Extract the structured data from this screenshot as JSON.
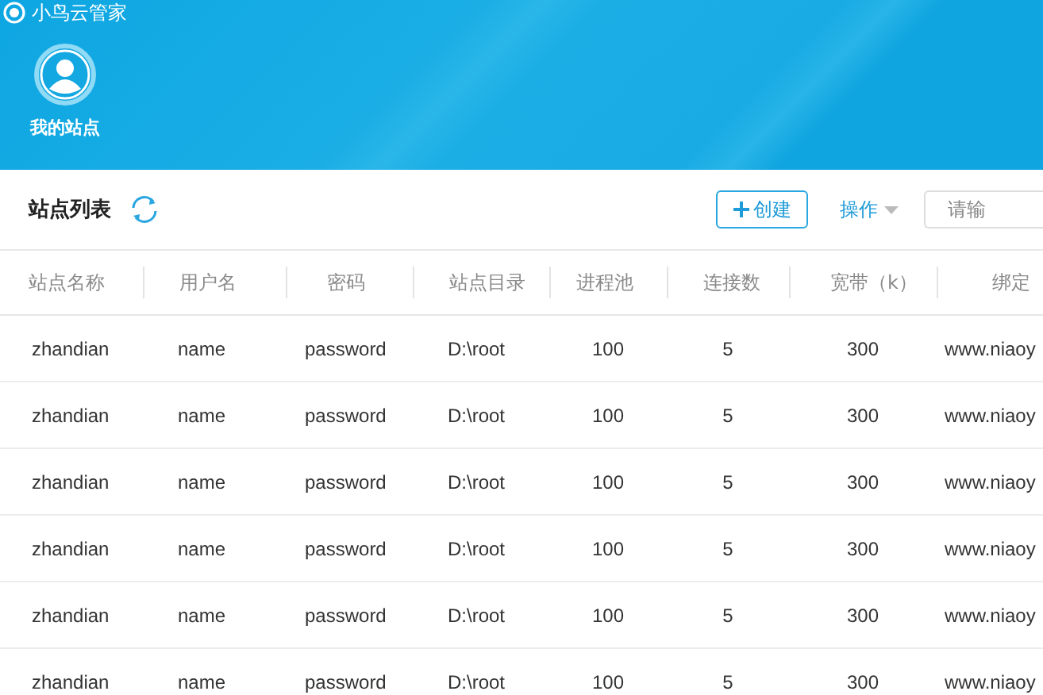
{
  "app_title": "小鸟云管家",
  "nav": {
    "label": "我的站点",
    "selected": true
  },
  "toolbar": {
    "title": "站点列表",
    "create_button": "创建",
    "actions_menu": "操作",
    "search": {
      "placeholder": "请输"
    }
  },
  "table": {
    "columns": [
      "站点名称",
      "用户名",
      "密码",
      "站点目录",
      "进程池",
      "连接数",
      "宽带（k）",
      "绑定"
    ],
    "rows": [
      [
        "zhandian",
        "name",
        "password",
        "D:\\root",
        "100",
        "5",
        "300",
        "www.niaoy"
      ],
      [
        "zhandian",
        "name",
        "password",
        "D:\\root",
        "100",
        "5",
        "300",
        "www.niaoy"
      ],
      [
        "zhandian",
        "name",
        "password",
        "D:\\root",
        "100",
        "5",
        "300",
        "www.niaoy"
      ],
      [
        "zhandian",
        "name",
        "password",
        "D:\\root",
        "100",
        "5",
        "300",
        "www.niaoy"
      ],
      [
        "zhandian",
        "name",
        "password",
        "D:\\root",
        "100",
        "5",
        "300",
        "www.niaoy"
      ],
      [
        "zhandian",
        "name",
        "password",
        "D:\\root",
        "100",
        "5",
        "300",
        "www.niaoy"
      ]
    ]
  }
}
